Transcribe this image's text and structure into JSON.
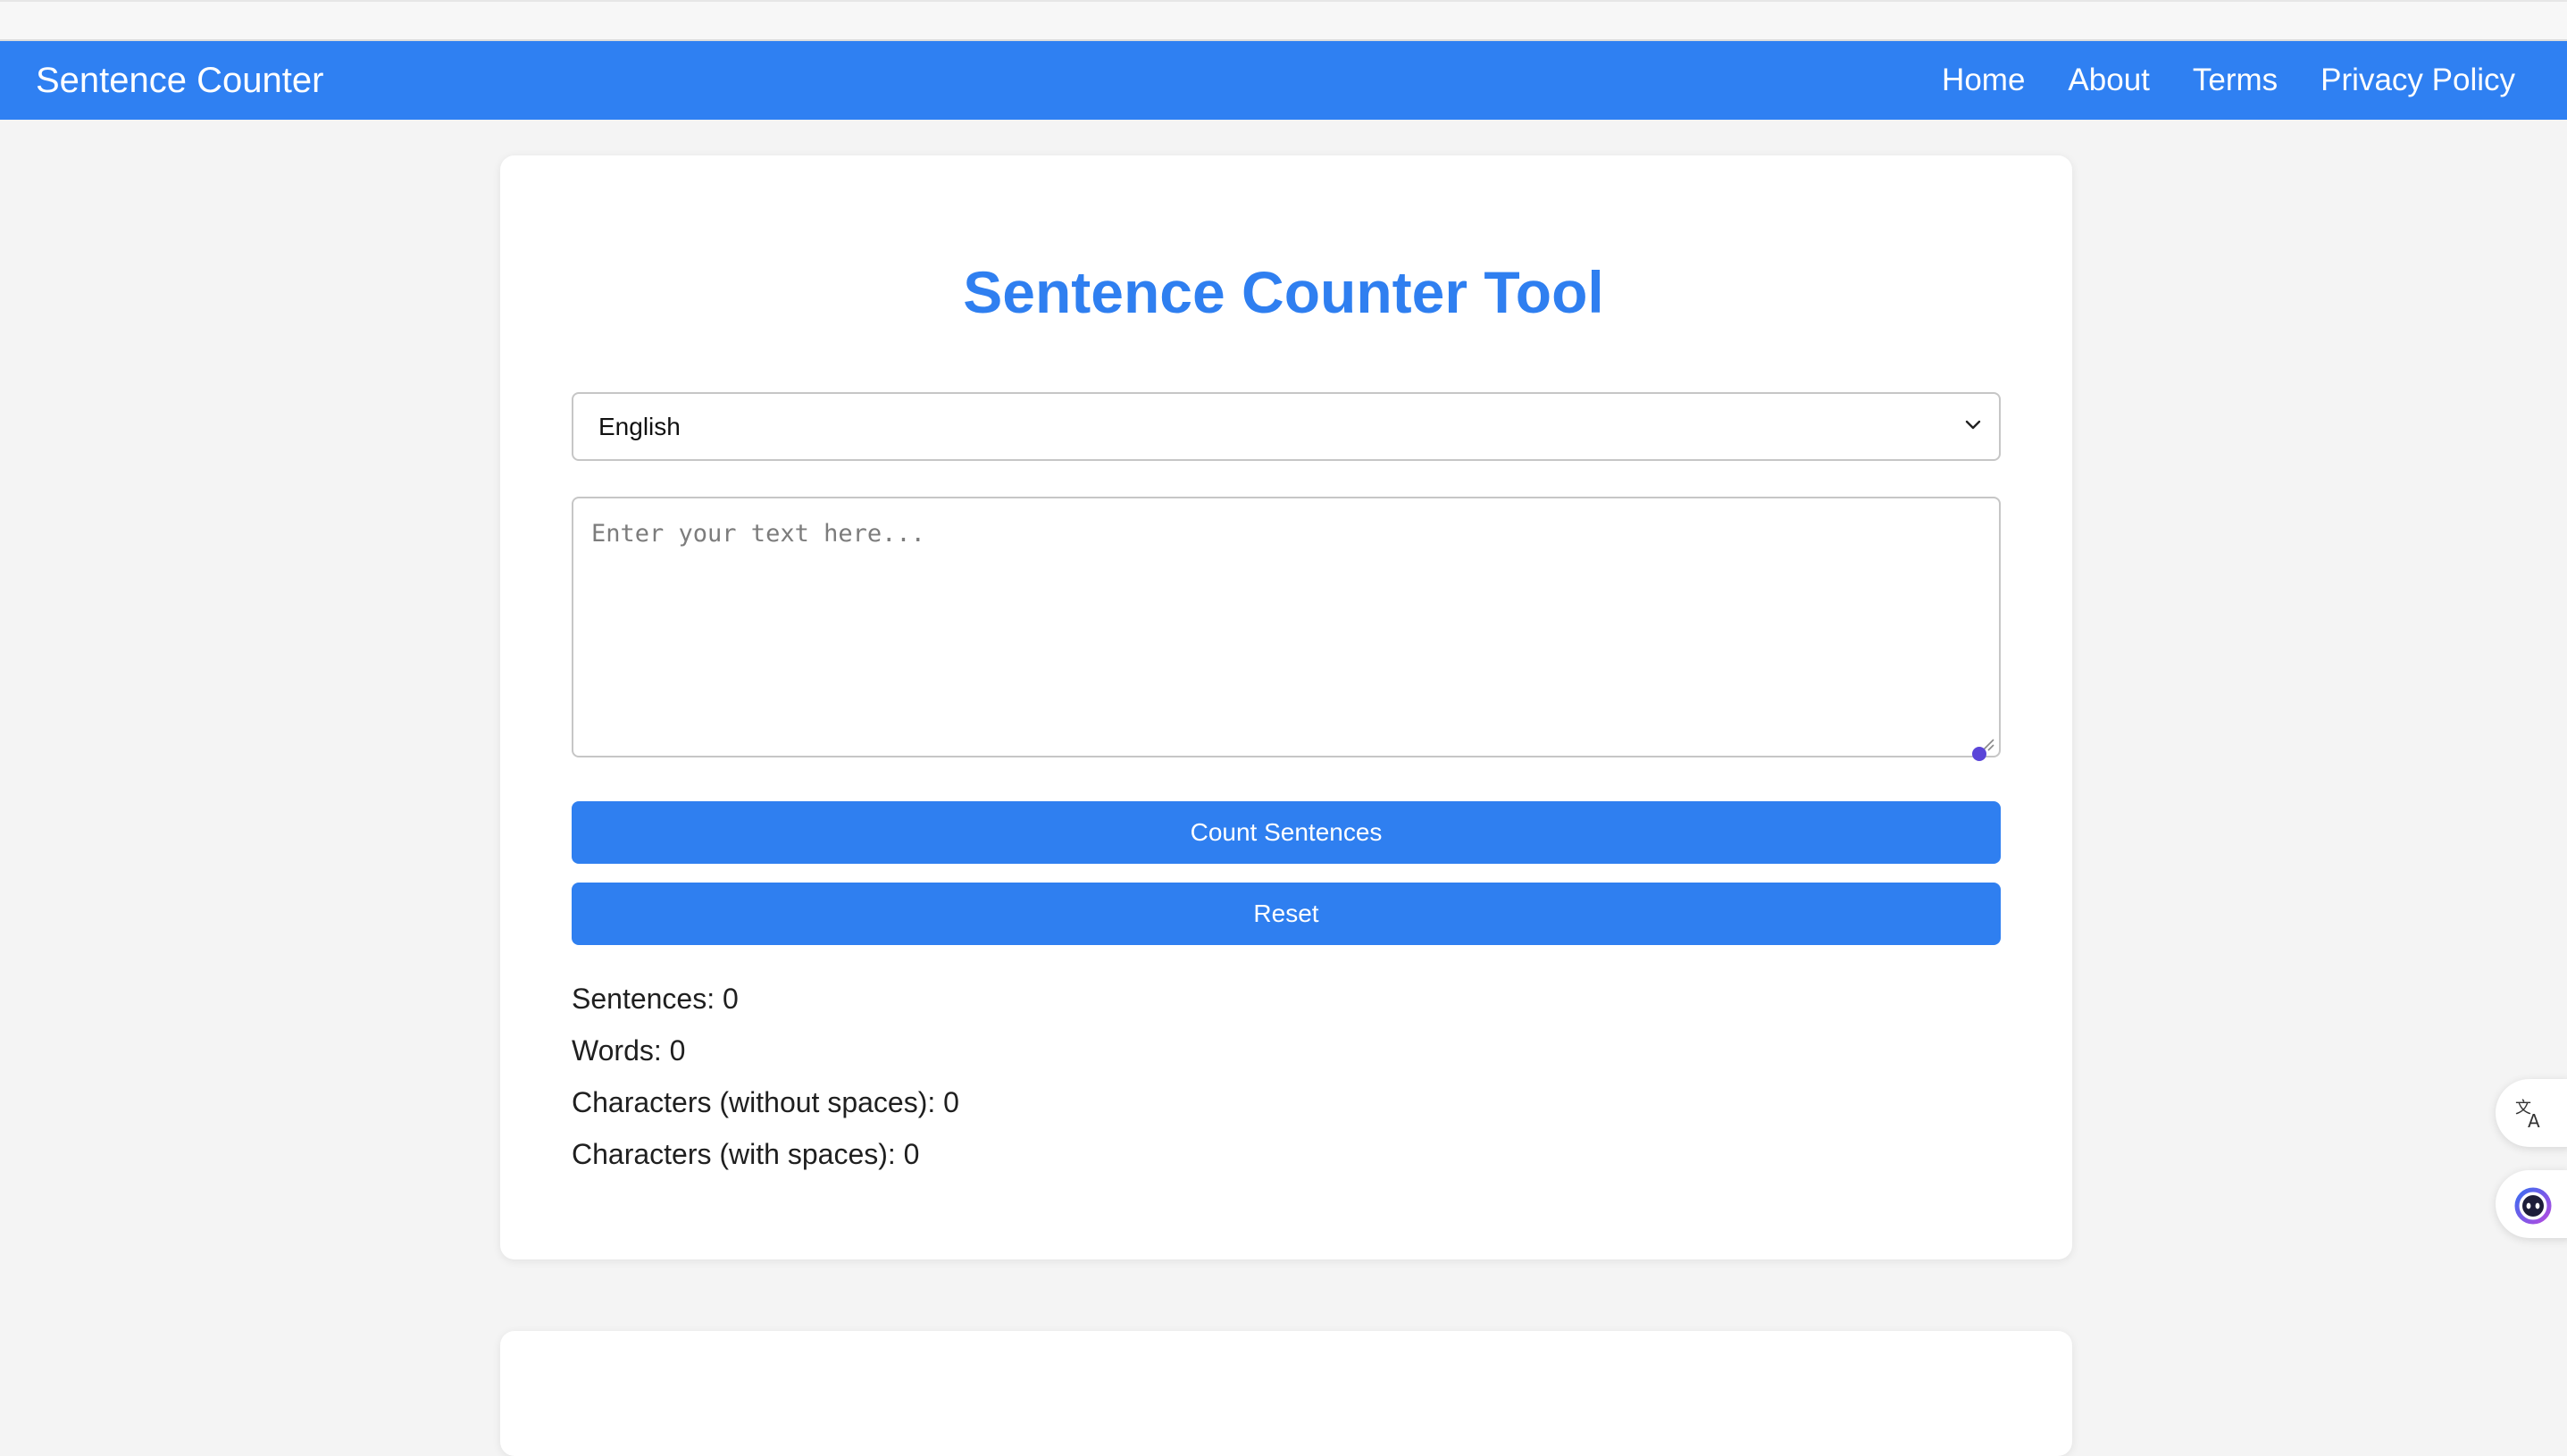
{
  "navbar": {
    "brand": "Sentence Counter",
    "links": [
      "Home",
      "About",
      "Terms",
      "Privacy Policy"
    ],
    "bg_color": "#2f80f2"
  },
  "main": {
    "title": "Sentence Counter Tool",
    "language_select": {
      "selected": "English"
    },
    "text_input": {
      "placeholder": "Enter your text here...",
      "value": ""
    },
    "count_button_label": "Count Sentences",
    "reset_button_label": "Reset",
    "stats": [
      "Sentences: 0",
      "Words: 0",
      "Characters (without spaces): 0",
      "Characters (with spaces): 0"
    ]
  },
  "colors": {
    "accent": "#2f7ff0",
    "page_bg": "#f4f4f4"
  },
  "floating_widgets": {
    "translate_icon": "translate-icon",
    "assistant_icon": "assistant-face-icon"
  }
}
